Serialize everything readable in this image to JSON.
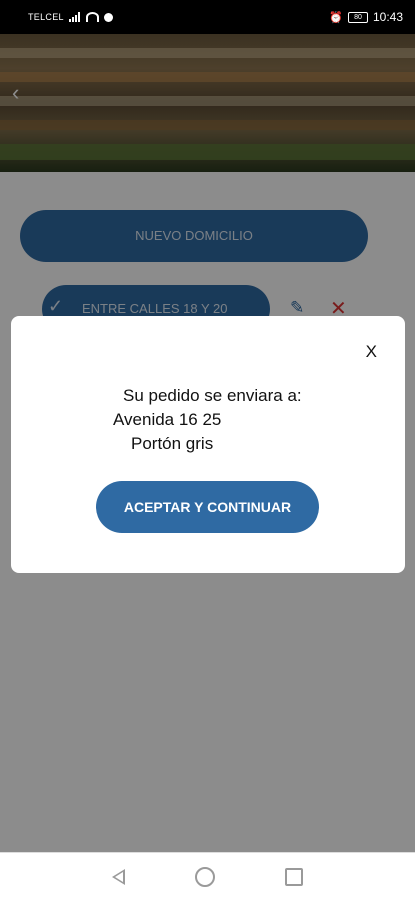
{
  "status_bar": {
    "carrier": "TELCEL",
    "battery": "80",
    "time": "10:43"
  },
  "header": {
    "back_icon": "chevron-left-icon"
  },
  "main": {
    "new_address_label": "NUEVO DOMICILIO",
    "address_item_label": "ENTRE CALLES 18 Y 20"
  },
  "dialog": {
    "message_line1": "Su pedido se enviara a:",
    "message_line2": "Avenida 16 25",
    "message_line3": "Portón gris",
    "close_label": "X",
    "accept_label": "ACEPTAR Y CONTINUAR"
  },
  "colors": {
    "primary": "#2f6aa3",
    "danger": "#d33"
  }
}
